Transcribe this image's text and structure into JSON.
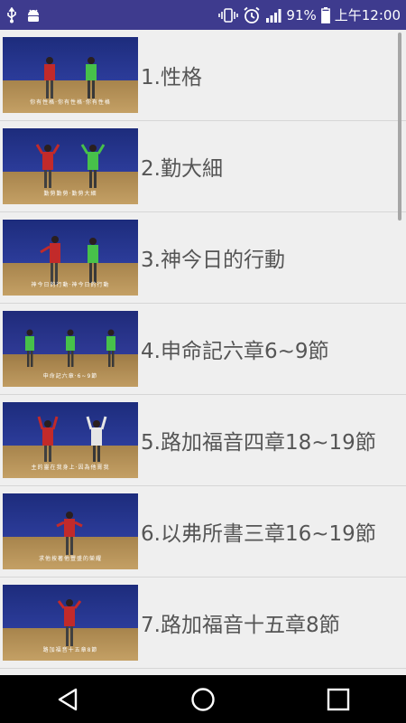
{
  "status_bar": {
    "battery": "91%",
    "time": "上午12:00",
    "icons": [
      "usb-icon",
      "android-debug-icon",
      "vibrate-icon",
      "alarm-icon",
      "signal-icon",
      "battery-icon"
    ]
  },
  "list": {
    "items": [
      {
        "title": "1.性格",
        "caption": "你有性格·你有性格·你有性格"
      },
      {
        "title": "2.勤大細",
        "caption": "勤勞勤勞·勤勞大細"
      },
      {
        "title": "3.神今日的行動",
        "caption": "神今日的行動·神今日的行動"
      },
      {
        "title": "4.申命記六章6~9節",
        "caption": "申命記六章·6~9節"
      },
      {
        "title": "5.路加福音四章18~19節",
        "caption": "主的靈在我身上·因為他膏我"
      },
      {
        "title": "6.以弗所書三章16~19節",
        "caption": "求他按著他豐盛的榮耀"
      },
      {
        "title": "7.路加福音十五章8節",
        "caption": "路加福音十五章8節"
      }
    ]
  },
  "nav_bar": {
    "icons": [
      "back-icon",
      "home-icon",
      "recents-icon"
    ]
  }
}
